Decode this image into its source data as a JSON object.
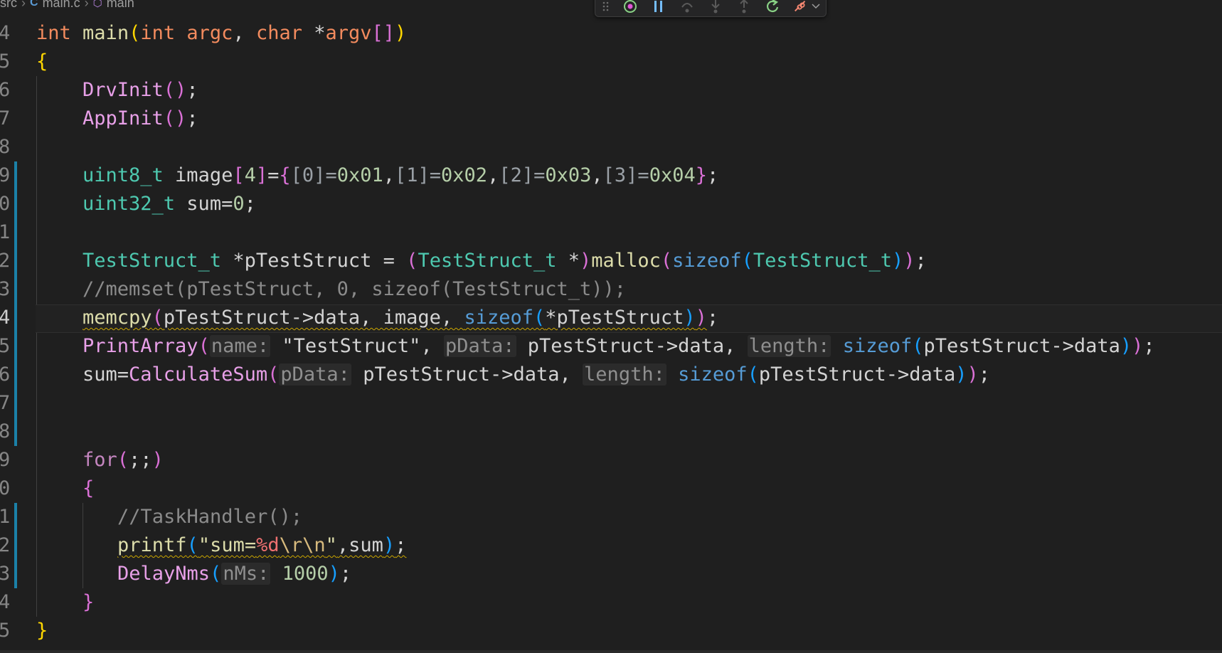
{
  "breadcrumb": {
    "folder": "src",
    "file": "main.c",
    "symbol": "main"
  },
  "debug_toolbar": {
    "buttons": [
      "drag-grip",
      "continue",
      "pause",
      "step-over",
      "step-into",
      "step-out",
      "restart",
      "disconnect",
      "more"
    ]
  },
  "gutter": [
    "4",
    "5",
    "6",
    "7",
    "8",
    "9",
    "0",
    "1",
    "2",
    "3",
    "4",
    "5",
    "6",
    "7",
    "8",
    "9",
    "0",
    "1",
    "2",
    "3",
    "4",
    "5"
  ],
  "code": {
    "l01": {
      "t1": "int",
      "t2": "main",
      "t3": "(",
      "t4": "int",
      "t5": "argc",
      "t6": ", ",
      "t7": "char",
      "t8": " *",
      "t9": "argv",
      "t10": "[]",
      "t11": ")"
    },
    "l02": {
      "t1": "{"
    },
    "l03": {
      "t1": "DrvInit",
      "t2": "()",
      "t3": ";"
    },
    "l04": {
      "t1": "AppInit",
      "t2": "()",
      "t3": ";"
    },
    "l06": {
      "t1": "uint8_t",
      "t2": " image",
      "t3": "[",
      "t4": "4",
      "t5": "]",
      "t6": "=",
      "t7": "{",
      "t8": "[0]=",
      "t9": "0x01",
      "t10": ",",
      "t11": "[1]=",
      "t12": "0x02",
      "t13": ",",
      "t14": "[2]=",
      "t15": "0x03",
      "t16": ",",
      "t17": "[3]=",
      "t18": "0x04",
      "t19": "}",
      "t20": ";"
    },
    "l07": {
      "t1": "uint32_t",
      "t2": " sum=",
      "t3": "0",
      "t4": ";"
    },
    "l09": {
      "t1": "TestStruct_t",
      "t2": " *pTestStruct = ",
      "t3": "(",
      "t4": "TestStruct_t",
      "t5": " *",
      "t6": ")",
      "t7": "malloc",
      "t8": "(",
      "t9": "sizeof",
      "t10": "(",
      "t11": "TestStruct_t",
      "t12": ")",
      "t13": ")",
      "t14": ";"
    },
    "l10": {
      "t1": "//memset(pTestStruct, 0, sizeof(TestStruct_t));"
    },
    "l11": {
      "t1": "memcpy",
      "t2": "(",
      "t3": "pTestStruct->data, image, ",
      "t4": "sizeof",
      "t5": "(",
      "t6": "*pTestStruct",
      "t7": ")",
      "t8": ")",
      "t9": ";"
    },
    "l12": {
      "t1": "PrintArray",
      "t2": "(",
      "h1": "name:",
      "t3": "\"TestStruct\"",
      "t4": ", ",
      "h2": "pData:",
      "t5": "pTestStruct->data, ",
      "h3": "length:",
      "t6": "sizeof",
      "t7": "(",
      "t8": "pTestStruct->data",
      "t9": ")",
      "t10": ")",
      "t11": ";"
    },
    "l13": {
      "t1": "sum=",
      "t2": "CalculateSum",
      "t3": "(",
      "h1": "pData:",
      "t4": "pTestStruct->data, ",
      "h2": "length:",
      "t5": "sizeof",
      "t6": "(",
      "t7": "pTestStruct->data",
      "t8": ")",
      "t9": ")",
      "t10": ";"
    },
    "l16": {
      "t1": "for",
      "t2": "(",
      "t3": ";;",
      "t4": ")"
    },
    "l17": {
      "t1": "{"
    },
    "l18": {
      "t1": "//TaskHandler();"
    },
    "l19": {
      "t1": "printf",
      "t2": "(",
      "t3": "\"sum=",
      "t4": "%d",
      "t5": "\\r\\n",
      "t6": "\"",
      "t7": ",sum",
      "t8": ")",
      "t9": ";"
    },
    "l20": {
      "t1": "DelayNms",
      "t2": "(",
      "h1": "nMs:",
      "t3": "1000",
      "t4": ")",
      "t5": ";"
    },
    "l21": {
      "t1": "}"
    },
    "l22": {
      "t1": "}"
    }
  },
  "colors": {
    "background": "#1f1f1f",
    "modified_gutter": "#1b81a8",
    "warning_squiggle": "#cca700"
  }
}
